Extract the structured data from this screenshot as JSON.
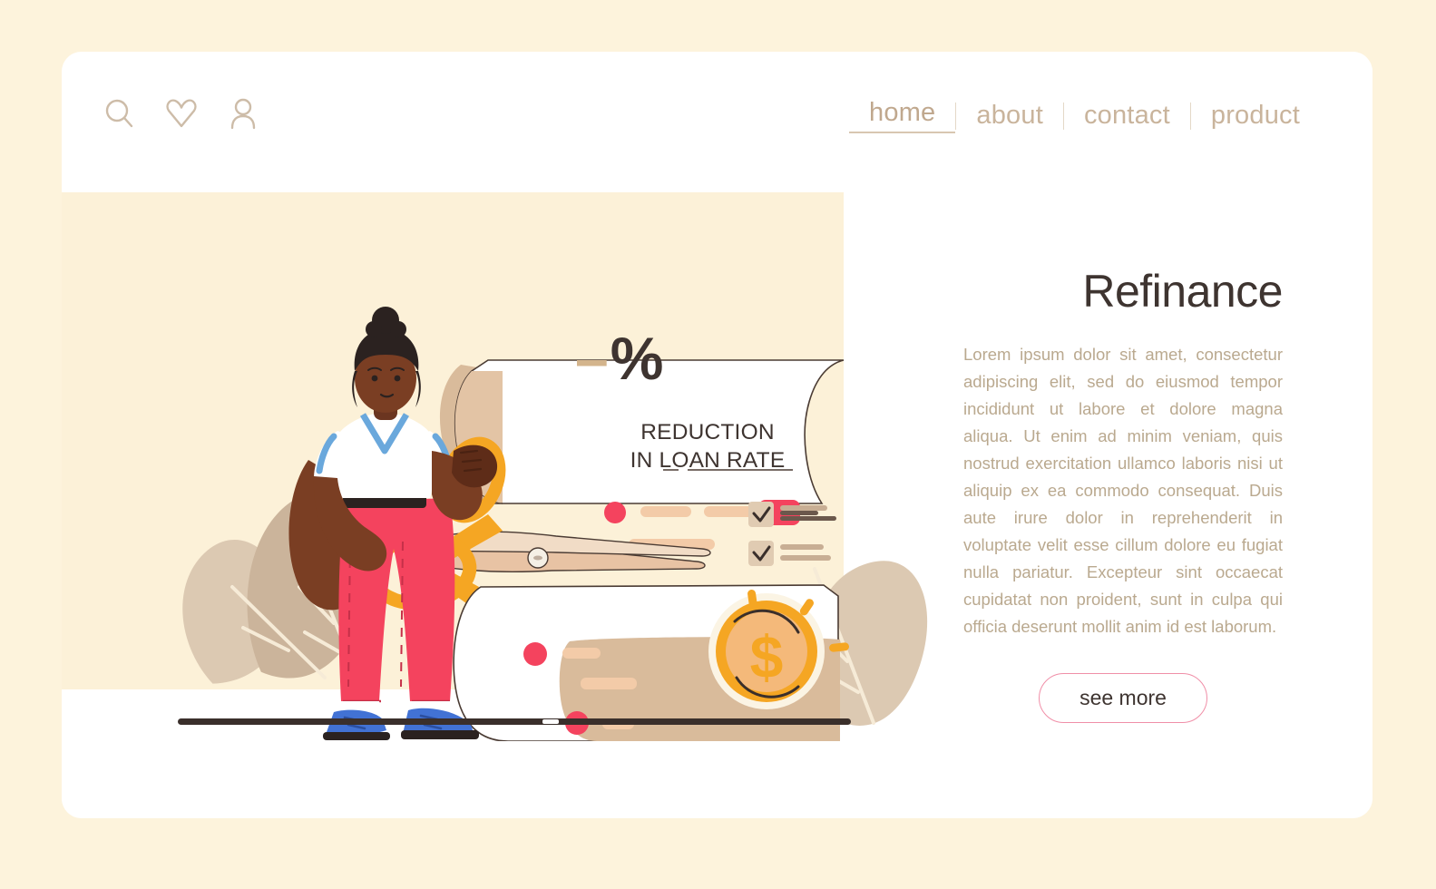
{
  "page": {
    "background_color": "#FDF3DC",
    "card_color": "#FFFFFF",
    "hero_blob_color": "#FCF1D8"
  },
  "header": {
    "icons": [
      {
        "name": "search-icon",
        "label": "search"
      },
      {
        "name": "heart-icon",
        "label": "favorites"
      },
      {
        "name": "user-icon",
        "label": "account"
      }
    ],
    "nav": [
      {
        "label": "home",
        "active": true
      },
      {
        "label": "about",
        "active": false
      },
      {
        "label": "contact",
        "active": false
      },
      {
        "label": "product",
        "active": false
      }
    ],
    "nav_color": "#C9B49C",
    "nav_active_underline": "#D8C6B1"
  },
  "main": {
    "title": "Refinance",
    "title_color": "#3E3430",
    "paragraph": "Lorem ipsum dolor sit amet, consectetur adipiscing elit, sed do eiusmod tempor incididunt ut labore et dolore magna aliqua. Ut enim ad minim veniam, quis nostrud exercitation ullamco laboris nisi ut aliquip ex ea commodo consequat. Duis aute irure dolor in reprehenderit in voluptate velit esse cillum dolore eu fugiat nulla pariatur. Excepteur sint occaecat cupidatat non proident, sunt in culpa qui officia deserunt mollit anim id est laborum.",
    "paragraph_color": "#BAA98F",
    "cta_label": "see more",
    "cta_border_color": "#F08FA8",
    "cta_text_color": "#3E3430"
  },
  "illustration": {
    "percent_symbol": "%",
    "percent_dash": "–",
    "receipt_line_1": "REDUCTION",
    "receipt_line_2": "IN LOAN RATE",
    "receipt_text_color": "#3E3430",
    "coin_symbol": "$",
    "colors": {
      "skin": "#7A3E23",
      "hair": "#2B2220",
      "shirt": "#FFFFFF",
      "shirt_trim": "#6AA8DC",
      "pants": "#F4435E",
      "belt": "#2B2220",
      "shoes": "#4272D4",
      "shoe_sole": "#2B2220",
      "scissors_handle": "#F5A623",
      "scissors_blade": "#E8C3A4",
      "paper": "#FFFFFF",
      "paper_back": "#D9BB9B",
      "leaf": "#CBB49B",
      "leaf_light": "#DCC9B2",
      "coin": "#F5A623",
      "coin_face": "#F4B97A",
      "ground": "#3A2F2B",
      "accent_red": "#F4435E",
      "accent_peach": "#F3CBA8"
    },
    "checklist": [
      {
        "checked": true
      },
      {
        "checked": true
      }
    ],
    "receipt_dots": 4
  }
}
